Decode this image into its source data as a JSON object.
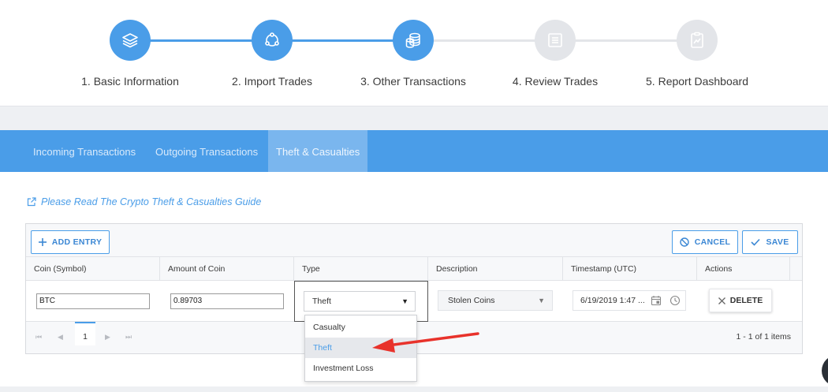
{
  "steps": [
    {
      "label": "1. Basic Information",
      "icon": "layers-icon",
      "state": "active"
    },
    {
      "label": "2. Import Trades",
      "icon": "share-nodes-icon",
      "state": "active"
    },
    {
      "label": "3. Other Transactions",
      "icon": "coins-icon",
      "state": "active"
    },
    {
      "label": "4. Review Trades",
      "icon": "list-icon",
      "state": "inactive"
    },
    {
      "label": "5. Report Dashboard",
      "icon": "chart-doc-icon",
      "state": "inactive"
    }
  ],
  "tabs": {
    "incoming": "Incoming Transactions",
    "outgoing": "Outgoing Transactions",
    "theft": "Theft & Casualties"
  },
  "guide_link": "Please Read The Crypto Theft & Casualties Guide",
  "toolbar": {
    "add_label": "ADD ENTRY",
    "cancel_label": "CANCEL",
    "save_label": "SAVE"
  },
  "columns": {
    "coin": "Coin (Symbol)",
    "amount": "Amount of Coin",
    "type": "Type",
    "description": "Description",
    "timestamp": "Timestamp (UTC)",
    "actions": "Actions"
  },
  "row": {
    "coin": "BTC",
    "amount": "0.89703",
    "type": "Theft",
    "description": "Stolen Coins",
    "timestamp": "6/19/2019 1:47 ...",
    "delete_label": "DELETE"
  },
  "type_options": [
    "Casualty",
    "Theft",
    "Investment Loss"
  ],
  "pager": {
    "page": "1",
    "info": "1 - 1 of 1 items"
  },
  "colors": {
    "accent": "#4a9de8",
    "annotation_arrow": "#e8322b"
  }
}
